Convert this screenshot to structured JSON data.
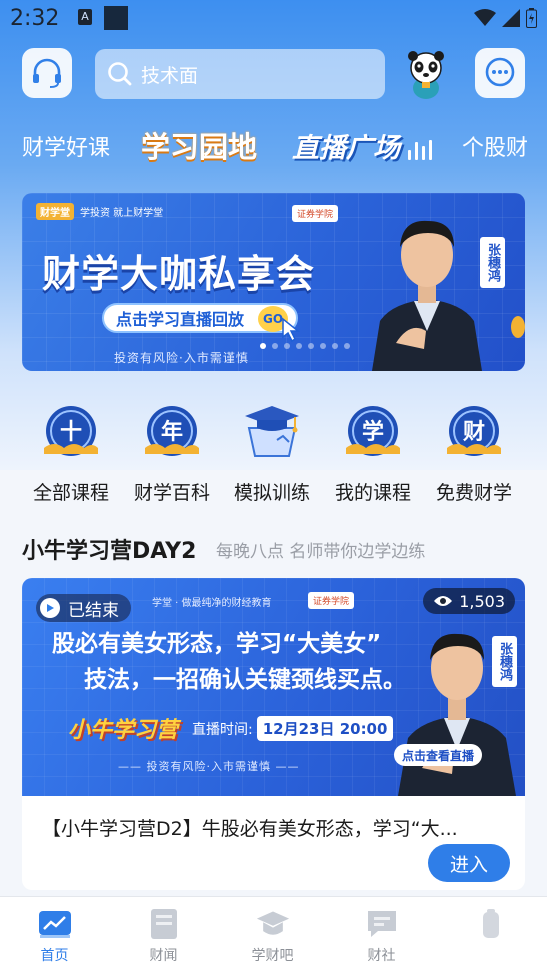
{
  "status_bar": {
    "time": "2:32",
    "notif_letter": "A"
  },
  "header": {
    "search_placeholder": "技术面"
  },
  "top_tabs": [
    {
      "label": "财学好课"
    },
    {
      "label": "学习园地"
    },
    {
      "label": "直播广场"
    },
    {
      "label": "个股财"
    }
  ],
  "banner": {
    "brand": "财学堂",
    "brand_slogan": "学投资 就上财学堂",
    "tag": "证券学院",
    "title": "财学大咖私享会",
    "cta": "点击学习直播回放",
    "cta_go": "GO",
    "risk": "投资有风险·入市需谨慎",
    "person_name": "张穗鸿"
  },
  "nav_icons": [
    {
      "glyph": "十",
      "label": "全部课程"
    },
    {
      "glyph": "年",
      "label": "财学百科"
    },
    {
      "glyph": "",
      "label": "模拟训练"
    },
    {
      "glyph": "学",
      "label": "我的课程"
    },
    {
      "glyph": "财",
      "label": "免费财学"
    }
  ],
  "section": {
    "title": "小牛学习营DAY2",
    "subtitle": "每晚八点 名师带你边学边练"
  },
  "course_card": {
    "status": "已结束",
    "views": "1,503",
    "top_text": "学堂 · 做最纯净的财经教育",
    "tag": "证券学院",
    "headline_line1": "股必有美女形态，学习“大美女”",
    "headline_line2": "技法，一招确认关键颈线买点。",
    "camp_logo": "小牛学习营",
    "live_time_label": "直播时间:",
    "live_time_value": "12月23日 20:00",
    "risk": "—— 投资有风险·入市需谨慎 ——",
    "watch_live": "点击查看直播",
    "person_name": "张穗鸿",
    "title": "【小牛学习营D2】牛股必有美女形态，学习“大...",
    "enter_button": "进入"
  },
  "bottom_nav": [
    {
      "label": "首页",
      "icon": "chart-icon"
    },
    {
      "label": "财闻",
      "icon": "news-icon"
    },
    {
      "label": "学财吧",
      "icon": "graduation-cap-icon"
    },
    {
      "label": "财社",
      "icon": "chat-icon"
    },
    {
      "label": "",
      "icon": "profile-icon"
    }
  ],
  "colors": {
    "primary_blue": "#2f7ee8",
    "header_gradient_top": "#3d8ff0",
    "accent_orange": "#f2a33a"
  }
}
